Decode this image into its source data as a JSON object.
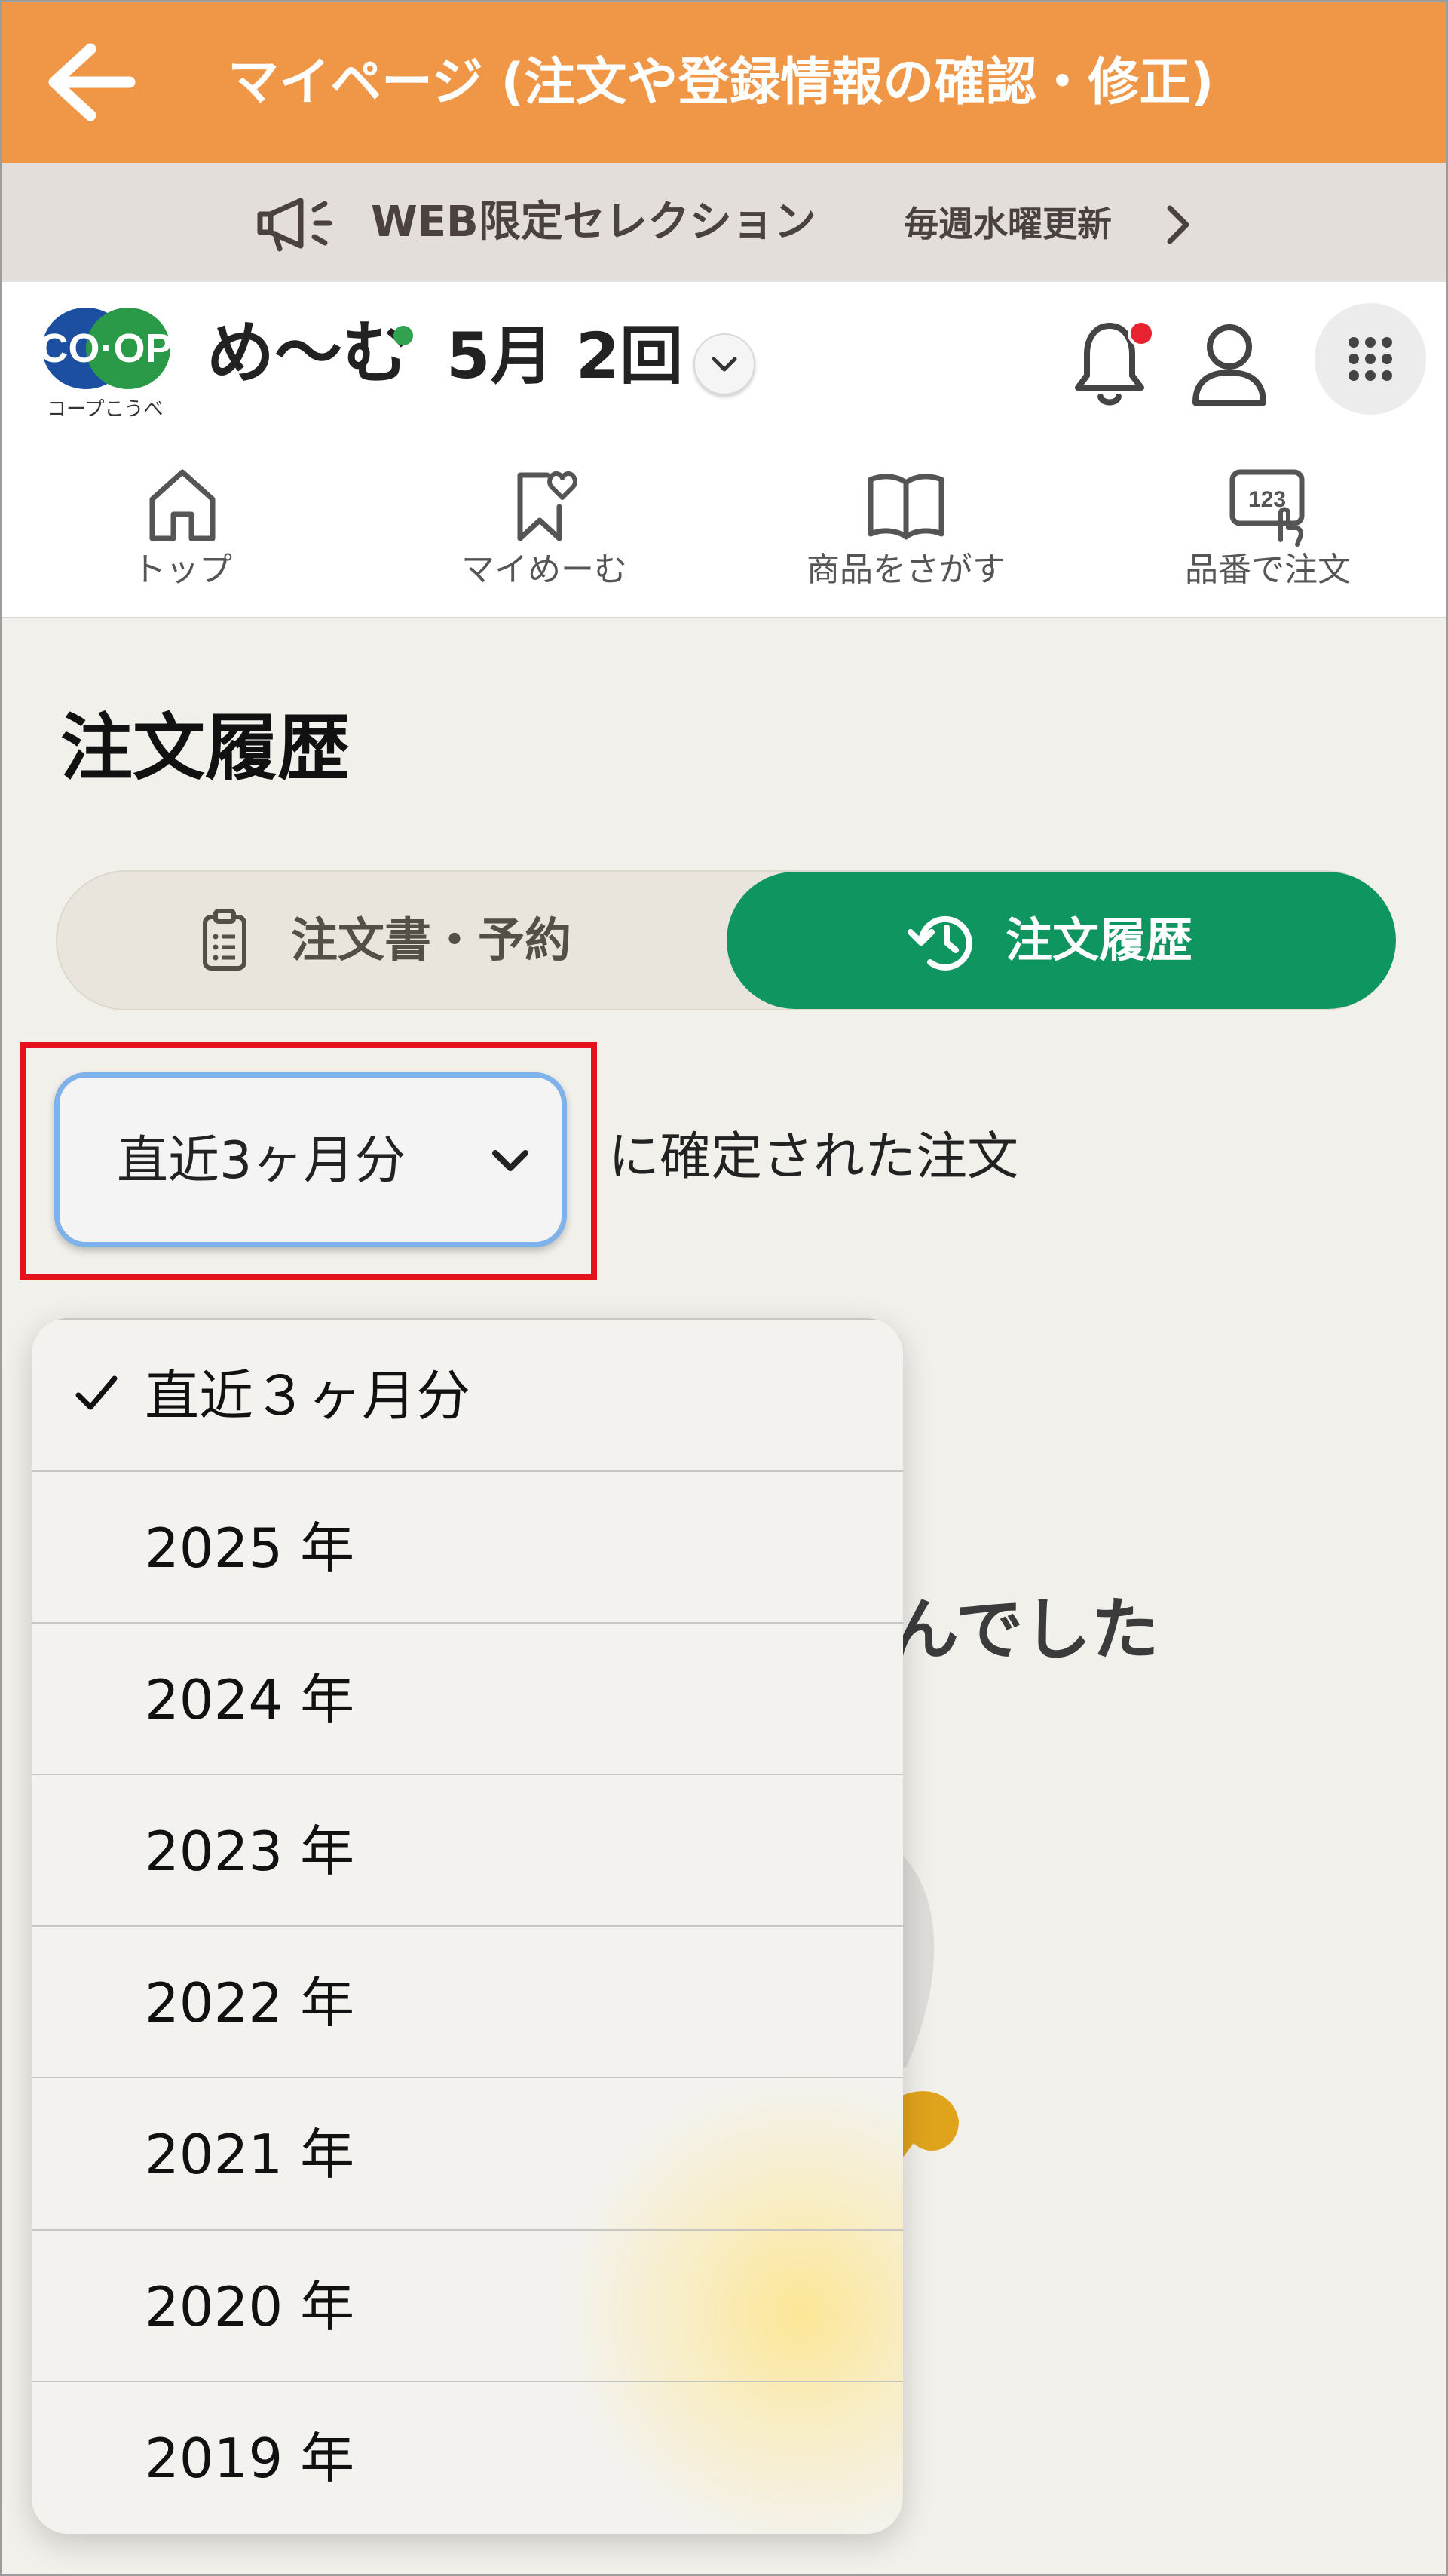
{
  "topbar": {
    "title": "マイページ (注文や登録情報の確認・修正)",
    "back_icon": "arrow-left-icon",
    "color": "#ef9647"
  },
  "banner": {
    "label": "WEB限定セレクション",
    "sub": "毎週水曜更新"
  },
  "header": {
    "logo_text": "CO·OP",
    "logo_sub": "コープこうべ",
    "brand": "め〜む",
    "period": "5月 2回"
  },
  "nav": [
    {
      "label": "トップ",
      "icon": "home-icon"
    },
    {
      "label": "マイめーむ",
      "icon": "bookmark-heart-icon"
    },
    {
      "label": "商品をさがす",
      "icon": "book-icon"
    },
    {
      "label": "品番で注文",
      "icon": "number-pad-icon"
    }
  ],
  "main": {
    "title": "注文履歴",
    "segments": [
      {
        "label": "注文書・予約",
        "active": false
      },
      {
        "label": "注文履歴",
        "active": true
      }
    ],
    "filter": {
      "selected": "直近3ヶ月分",
      "suffix": "に確定された注文"
    },
    "background_text": "んでした"
  },
  "dropdown": {
    "options": [
      {
        "label": "直近３ヶ月分",
        "checked": true
      },
      {
        "label": "2025 年",
        "checked": false
      },
      {
        "label": "2024 年",
        "checked": false
      },
      {
        "label": "2023 年",
        "checked": false
      },
      {
        "label": "2022 年",
        "checked": false
      },
      {
        "label": "2021 年",
        "checked": false
      },
      {
        "label": "2020 年",
        "checked": false
      },
      {
        "label": "2019 年",
        "checked": false
      }
    ]
  },
  "colors": {
    "accent": "#0e9560",
    "orange": "#ef9647",
    "highlight": "#e3131d"
  }
}
